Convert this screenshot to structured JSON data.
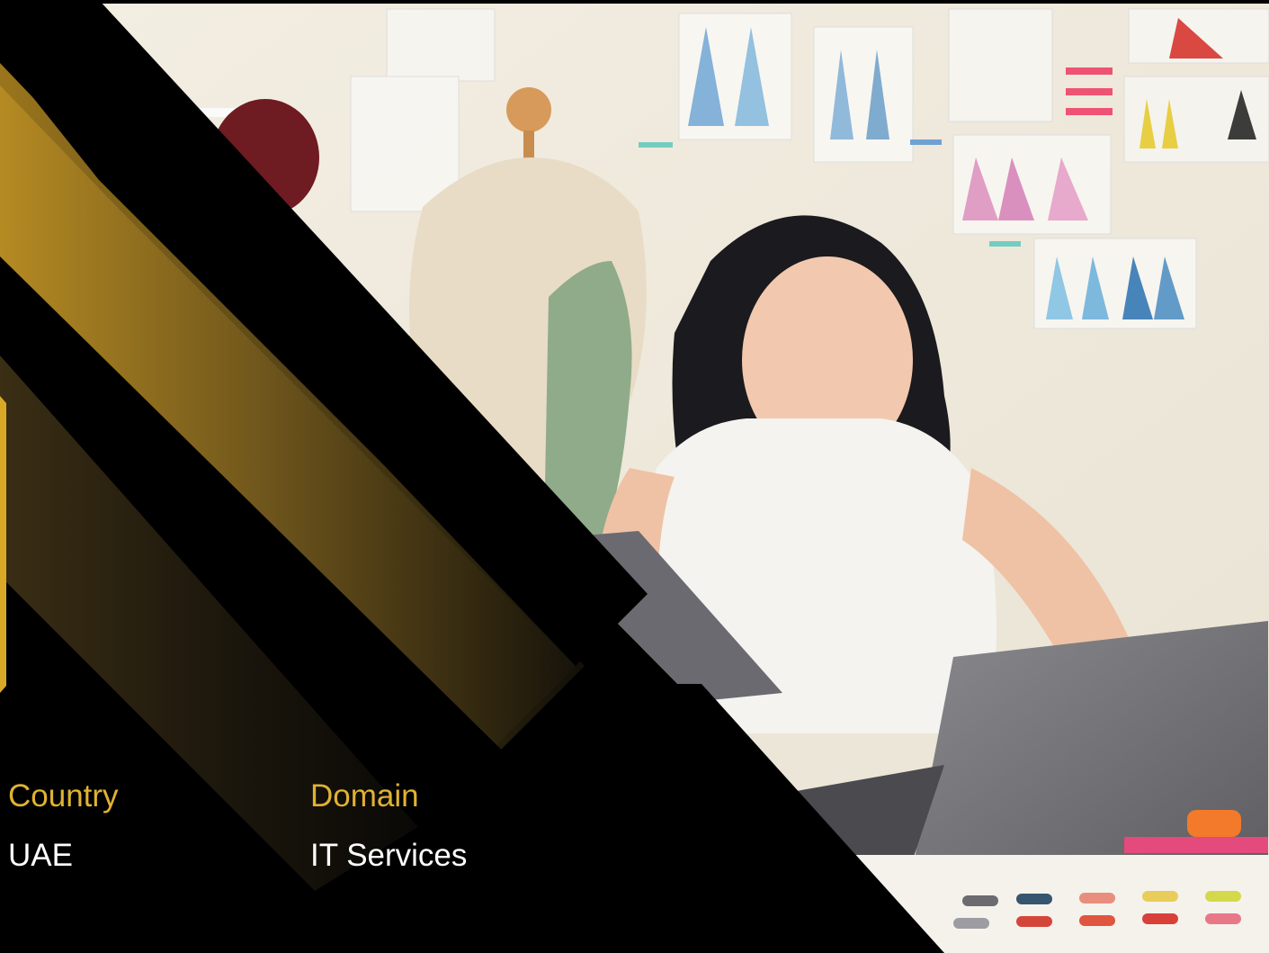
{
  "info": {
    "country_label": "Country",
    "country_value": "UAE",
    "domain_label": "Domain",
    "domain_value": "IT Services"
  },
  "colors": {
    "accent_gold": "#e0b233",
    "background": "#000000",
    "text": "#ffffff"
  },
  "icons": {
    "hero_image": "fashion-designer-photo",
    "side_bar": "gold-frame-edge"
  }
}
